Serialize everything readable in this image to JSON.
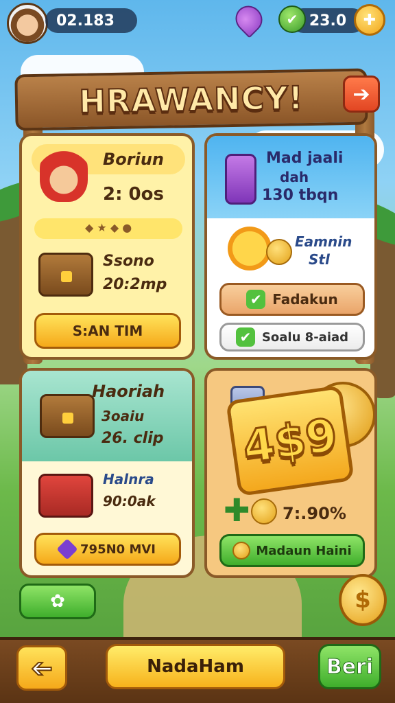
{
  "topbar": {
    "left_value": "02.183",
    "right_value": "23.0",
    "gem_icon": "purple-gem-icon",
    "check_icon": "green-check-icon",
    "coin_icon": "gold-coin-icon"
  },
  "header": {
    "title": "HRAWANCY!",
    "close_glyph": "➔"
  },
  "cards": {
    "a": {
      "name": "Boriun",
      "time": "2: 0os",
      "item_label": "Ssono",
      "item_price": "20:2mp",
      "button": "S:AN TIM"
    },
    "b": {
      "title_line1": "Mad jaali",
      "title_line2": "dah",
      "title_line3": "130 tbqn",
      "reward_line1": "Eamnin",
      "reward_line2": "Stl",
      "button1": "Fadakun",
      "button2": "Soalu 8-aiad"
    },
    "c": {
      "name": "Haoriah",
      "line1": "3oaiu",
      "line2": "26. clip",
      "item_label": "Halnra",
      "item_price": "90:0ak",
      "button": "795N0 MVI"
    },
    "d": {
      "badge": "4$9",
      "percent": "7:.90%",
      "button": "Madaun Haini"
    }
  },
  "bottom": {
    "back_glyph": "➔",
    "center": "NadaHam",
    "right": "Beri",
    "small_glyph": "✿",
    "corner_coin_glyph": "$"
  },
  "colors": {
    "accent_yellow": "#f5a91a",
    "accent_green": "#3fae2c",
    "wood": "#8b5628"
  }
}
